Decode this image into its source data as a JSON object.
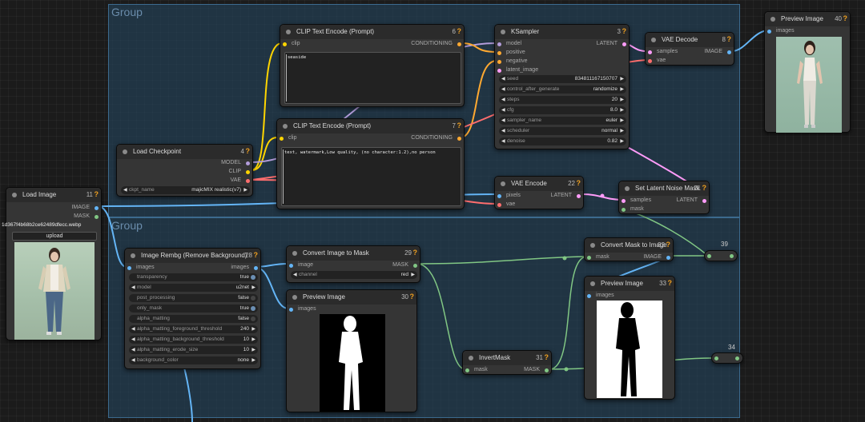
{
  "groups": [
    {
      "title": "Group"
    },
    {
      "title": "Group"
    }
  ],
  "colors": {
    "clip": "#ffd500",
    "conditioning": "#ffa931",
    "model": "#b39ddb",
    "latent": "#ff9cf9",
    "vae": "#ff6e6e",
    "image": "#64b5f6",
    "mask": "#81c784",
    "warn": "#f0a020"
  },
  "icons": {
    "warning": "?",
    "arrow_left": "◀",
    "arrow_right": "▶"
  },
  "nodes": {
    "load_image": {
      "title": "Load Image",
      "id": "11",
      "outputs": [
        "IMAGE",
        "MASK"
      ],
      "filename": "1d367f4b68b2ce62489dfecc.webp",
      "upload_label": "upload"
    },
    "load_checkpoint": {
      "title": "Load Checkpoint",
      "id": "4",
      "outputs": [
        "MODEL",
        "CLIP",
        "VAE"
      ],
      "ckpt_label": "ckpt_name",
      "ckpt_value": "majicMIX realistic(v7)"
    },
    "clip_pos": {
      "title": "CLIP Text Encode (Prompt)",
      "id": "6",
      "input": "clip",
      "output": "CONDITIONING",
      "text": "seaside"
    },
    "clip_neg": {
      "title": "CLIP Text Encode (Prompt)",
      "id": "7",
      "input": "clip",
      "output": "CONDITIONING",
      "text": "text, watermark,Low quality, (no character:1.2),no person"
    },
    "ksampler": {
      "title": "KSampler",
      "id": "3",
      "inputs": [
        "model",
        "positive",
        "negative",
        "latent_image"
      ],
      "output": "LATENT",
      "widgets": [
        {
          "label": "seed",
          "value": "834811167150707"
        },
        {
          "label": "control_after_generate",
          "value": "randomize"
        },
        {
          "label": "steps",
          "value": "20"
        },
        {
          "label": "cfg",
          "value": "8.0"
        },
        {
          "label": "sampler_name",
          "value": "euler"
        },
        {
          "label": "scheduler",
          "value": "normal"
        },
        {
          "label": "denoise",
          "value": "0.82"
        }
      ]
    },
    "vae_decode": {
      "title": "VAE Decode",
      "id": "8",
      "inputs": [
        "samples",
        "vae"
      ],
      "output": "IMAGE"
    },
    "preview_40": {
      "title": "Preview Image",
      "id": "40",
      "input": "images"
    },
    "vae_encode": {
      "title": "VAE Encode",
      "id": "22",
      "inputs": [
        "pixels",
        "vae"
      ],
      "output": "LATENT"
    },
    "set_latent_mask": {
      "title": "Set Latent Noise Mask",
      "id": "21",
      "inputs": [
        "samples",
        "mask"
      ],
      "output": "LATENT"
    },
    "rembg": {
      "title": "Image Rembg (Remove Background)",
      "id": "28",
      "input": "images",
      "output": "images",
      "widgets": [
        {
          "label": "transparency",
          "value": "true",
          "kind": "toggle"
        },
        {
          "label": "model",
          "value": "u2net",
          "kind": "combo"
        },
        {
          "label": "post_processing",
          "value": "false",
          "kind": "toggle"
        },
        {
          "label": "only_mask",
          "value": "true",
          "kind": "toggle"
        },
        {
          "label": "alpha_matting",
          "value": "false",
          "kind": "toggle"
        },
        {
          "label": "alpha_matting_foreground_threshold",
          "value": "240",
          "kind": "number"
        },
        {
          "label": "alpha_matting_background_threshold",
          "value": "10",
          "kind": "number"
        },
        {
          "label": "alpha_matting_erode_size",
          "value": "10",
          "kind": "number"
        },
        {
          "label": "background_color",
          "value": "none",
          "kind": "combo"
        }
      ]
    },
    "img_to_mask": {
      "title": "Convert Image to Mask",
      "id": "29",
      "input": "image",
      "output": "MASK",
      "channel_label": "channel",
      "channel_value": "red"
    },
    "preview_30": {
      "title": "Preview Image",
      "id": "30",
      "input": "images"
    },
    "mask_to_image": {
      "title": "Convert Mask to Image",
      "id": "32",
      "input": "mask",
      "output": "IMAGE"
    },
    "preview_33": {
      "title": "Preview Image",
      "id": "33",
      "input": "images"
    },
    "invert_mask": {
      "title": "InvertMask",
      "id": "31",
      "input": "mask",
      "output": "MASK"
    },
    "reroute_39": {
      "id": "39"
    },
    "reroute_34": {
      "id": "34"
    }
  }
}
